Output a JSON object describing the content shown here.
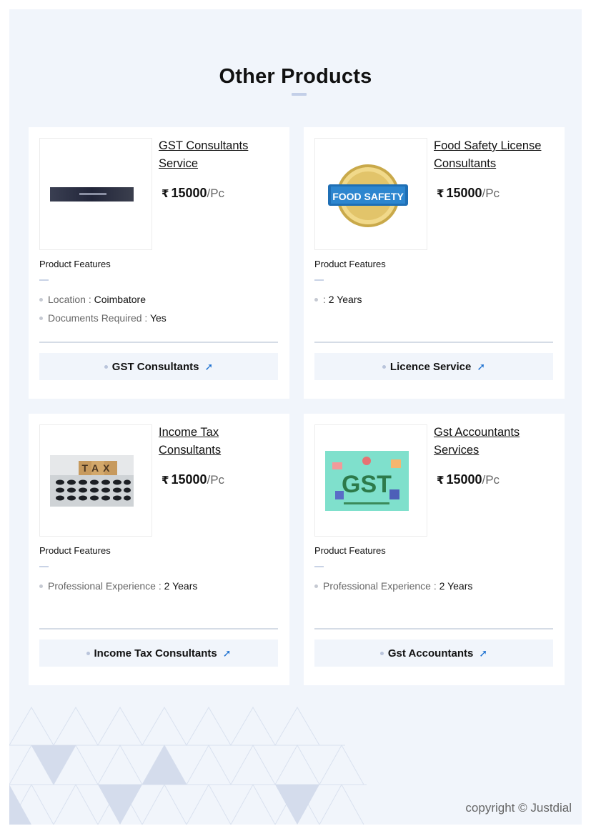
{
  "section": {
    "title": "Other Products"
  },
  "products": [
    {
      "name": "GST Consultants Service",
      "price": {
        "currency": "₹",
        "amount": "15000",
        "unit": "/Pc"
      },
      "features_title": "Product Features",
      "features": [
        {
          "label": "Location :",
          "value": "Coimbatore"
        },
        {
          "label": "Documents Required :",
          "value": "Yes"
        }
      ],
      "cta": "GST Consultants"
    },
    {
      "name": "Food Safety License Consultants",
      "price": {
        "currency": "₹",
        "amount": "15000",
        "unit": "/Pc"
      },
      "features_title": "Product Features",
      "features": [
        {
          "label": ":",
          "value": "2 Years"
        }
      ],
      "cta": "Licence Service",
      "image_text": {
        "badge": "FOOD SAFETY"
      }
    },
    {
      "name": "Income Tax Consultants",
      "price": {
        "currency": "₹",
        "amount": "15000",
        "unit": "/Pc"
      },
      "features_title": "Product Features",
      "features": [
        {
          "label": "Professional Experience :",
          "value": "2 Years"
        }
      ],
      "cta": "Income Tax Consultants",
      "image_text": {
        "blocks": "TAX"
      }
    },
    {
      "name": "Gst Accountants Services",
      "price": {
        "currency": "₹",
        "amount": "15000",
        "unit": "/Pc"
      },
      "features_title": "Product Features",
      "features": [
        {
          "label": "Professional Experience :",
          "value": "2 Years"
        }
      ],
      "cta": "Gst Accountants",
      "image_text": {
        "logo": "GST"
      }
    }
  ],
  "icons": {
    "arrow": "arrow-up-right-icon",
    "rupee": "rupee-icon"
  },
  "colors": {
    "page_bg": "#f1f5fb",
    "accent": "#1a6fd0",
    "bar": "#c3cfe8"
  },
  "footer": {
    "copyright": "copyright © Justdial"
  }
}
